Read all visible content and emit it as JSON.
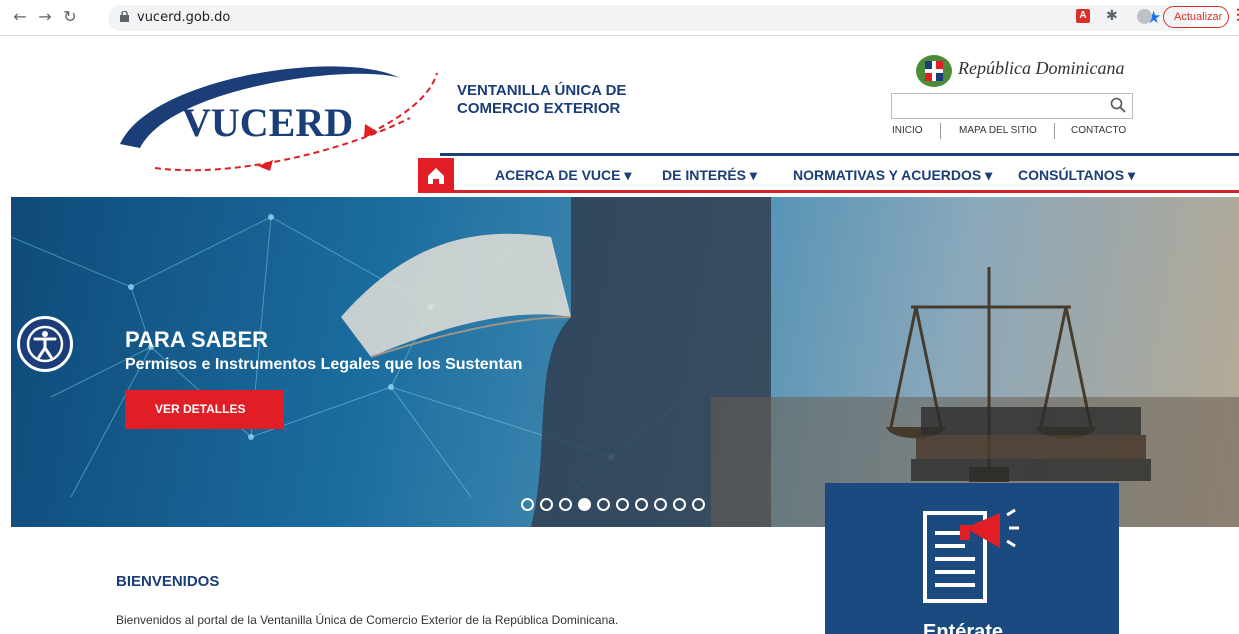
{
  "browser": {
    "url": "vucerd.gob.do",
    "update_label": "Actualizar",
    "ext_pdf_label": "A"
  },
  "header": {
    "logo_text": "VUCERD",
    "title_line1": "VENTANILLA ÚNICA DE",
    "title_line2": "COMERCIO EXTERIOR",
    "country_name": "República Dominicana",
    "search_value": "",
    "top_links": [
      "INICIO",
      "MAPA DEL SITIO",
      "CONTACTO"
    ]
  },
  "nav": {
    "items": [
      "ACERCA DE VUCE",
      "DE INTERÉS",
      "NORMATIVAS Y ACUERDOS",
      "CONSÚLTANOS"
    ]
  },
  "hero": {
    "title": "PARA SABER",
    "subtitle": "Permisos e Instrumentos Legales que los Sustentan",
    "button": "VER DETALLES",
    "slide_count": 10,
    "active_slide": 4
  },
  "welcome": {
    "heading": "BIENVENIDOS",
    "text": "Bienvenidos al portal de la Ventanilla Única de Comercio Exterior de la República Dominicana."
  },
  "card": {
    "label": "Entérate"
  },
  "colors": {
    "brand_blue": "#1b3e78",
    "brand_red": "#e11d25"
  }
}
